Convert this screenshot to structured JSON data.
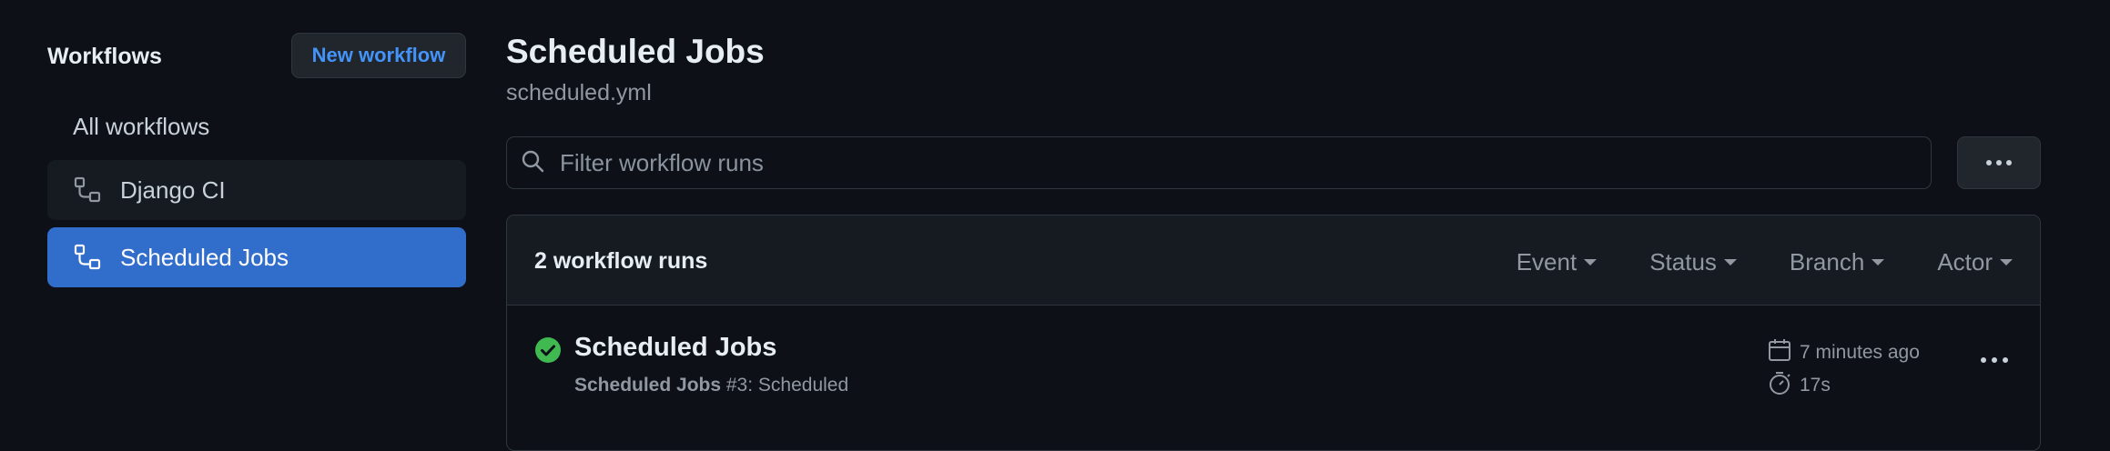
{
  "sidebar": {
    "title": "Workflows",
    "new_workflow_label": "New workflow",
    "items": [
      {
        "label": "All workflows"
      },
      {
        "label": "Django CI",
        "icon": "workflow-icon"
      },
      {
        "label": "Scheduled Jobs",
        "icon": "workflow-icon",
        "selected": true
      }
    ]
  },
  "main": {
    "title": "Scheduled Jobs",
    "subtitle": "scheduled.yml",
    "filter": {
      "placeholder": "Filter workflow runs",
      "value": ""
    },
    "runs": {
      "count_label": "2 workflow runs",
      "filters": [
        "Event",
        "Status",
        "Branch",
        "Actor"
      ],
      "rows": [
        {
          "title": "Scheduled Jobs",
          "sub_bold": "Scheduled Jobs",
          "sub_rest": " #3: Scheduled",
          "status": "success",
          "time": "7 minutes ago",
          "duration": "17s"
        }
      ]
    }
  },
  "colors": {
    "background": "#0d1117",
    "accent_blue": "#316dca",
    "link_blue": "#4493f8",
    "success_green": "#3fb950",
    "muted_text": "#9198a1"
  }
}
